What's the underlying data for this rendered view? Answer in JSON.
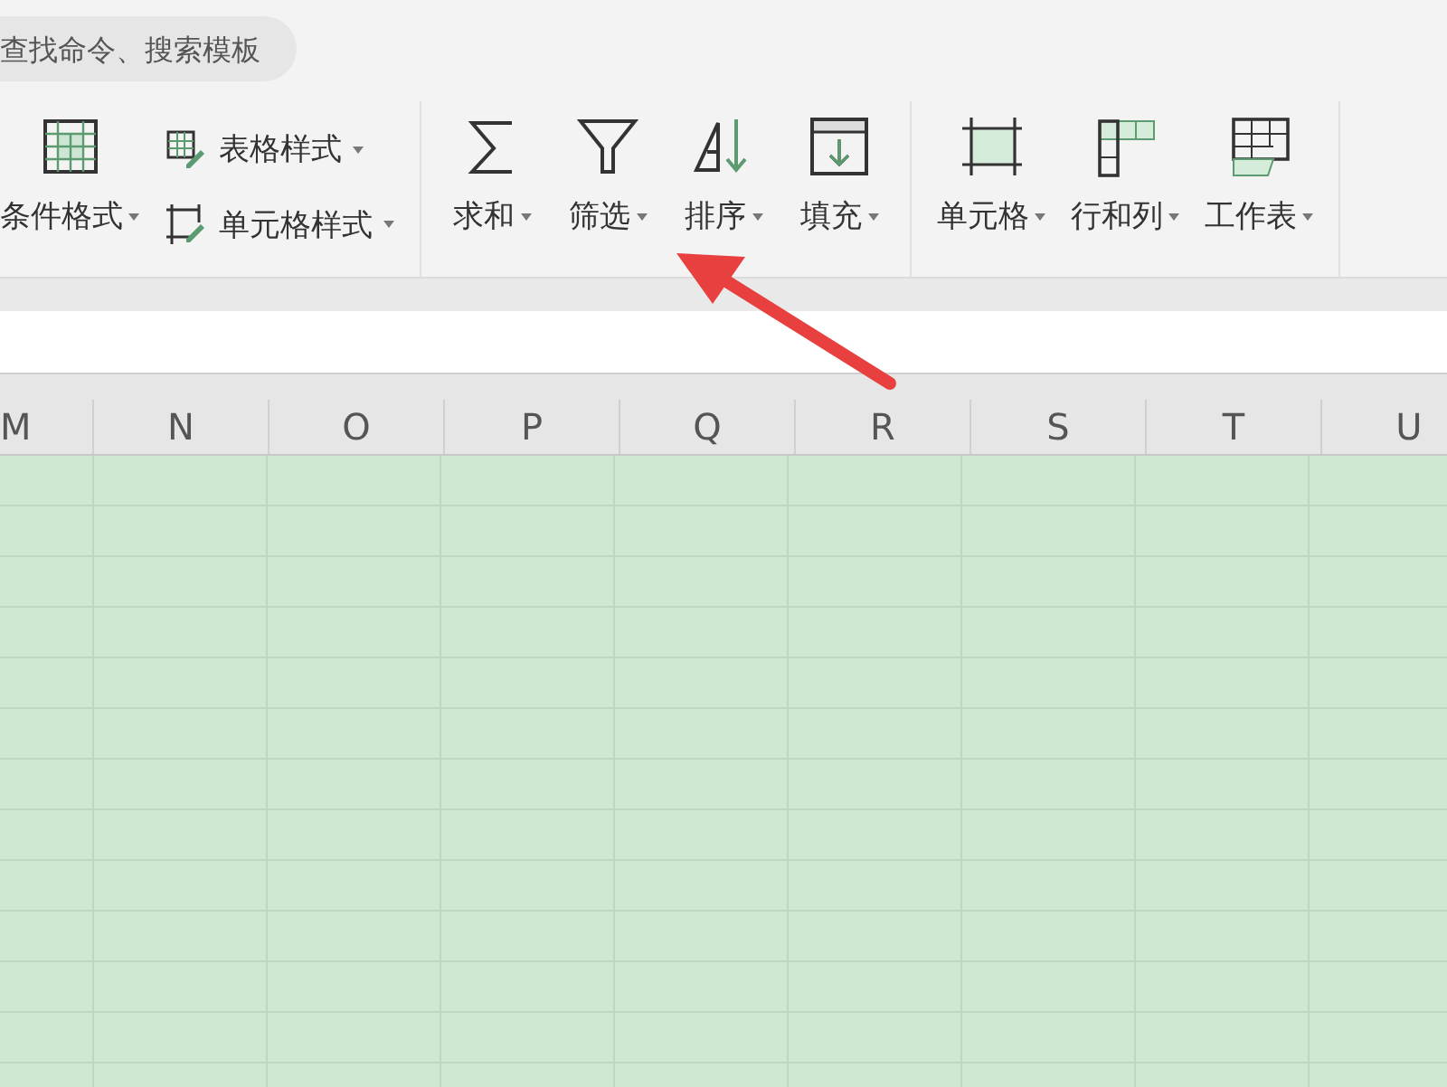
{
  "search": {
    "placeholder": "查找命令、搜索模板"
  },
  "ribbon": {
    "groups": [
      {
        "buttons": [
          {
            "kind": "large",
            "label": "条件格式"
          },
          {
            "kind": "small",
            "label": "表格样式"
          },
          {
            "kind": "small",
            "label": "单元格样式"
          }
        ]
      },
      {
        "buttons": [
          {
            "kind": "large",
            "label": "求和"
          },
          {
            "kind": "large",
            "label": "筛选"
          },
          {
            "kind": "large",
            "label": "排序"
          },
          {
            "kind": "large",
            "label": "填充"
          }
        ]
      },
      {
        "buttons": [
          {
            "kind": "large",
            "label": "单元格"
          },
          {
            "kind": "large",
            "label": "行和列"
          },
          {
            "kind": "large",
            "label": "工作表"
          }
        ]
      }
    ]
  },
  "sheet": {
    "columns": [
      "M",
      "N",
      "O",
      "P",
      "Q",
      "R",
      "S",
      "T",
      "U"
    ]
  }
}
